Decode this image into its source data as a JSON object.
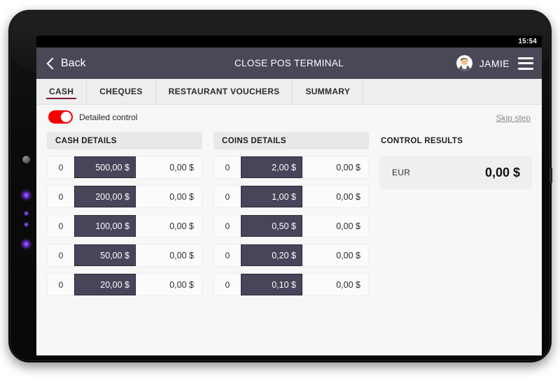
{
  "status_bar": {
    "clock": "15:54"
  },
  "header": {
    "back_label": "Back",
    "title": "CLOSE POS TERMINAL",
    "user_name": "JAMIE",
    "back_icon": "chevron-left-icon",
    "menu_icon": "hamburger-menu-icon",
    "avatar_icon": "user-avatar-icon"
  },
  "tabs": [
    {
      "label": "CASH",
      "active": true
    },
    {
      "label": "CHEQUES",
      "active": false
    },
    {
      "label": "RESTAURANT VOUCHERS",
      "active": false
    },
    {
      "label": "SUMMARY",
      "active": false
    }
  ],
  "toolbar": {
    "detailed_control_label": "Detailed control",
    "detailed_control_on": true,
    "toggle_color": "#f40000",
    "skip_step_label": "Skip step"
  },
  "cash_section": {
    "header": "CASH DETAILS",
    "rows": [
      {
        "count": "0",
        "denomination": "500,00 $",
        "total": "0,00 $"
      },
      {
        "count": "0",
        "denomination": "200,00 $",
        "total": "0,00 $"
      },
      {
        "count": "0",
        "denomination": "100,00 $",
        "total": "0,00 $"
      },
      {
        "count": "0",
        "denomination": "50,00 $",
        "total": "0,00 $"
      },
      {
        "count": "0",
        "denomination": "20,00 $",
        "total": "0,00 $"
      }
    ]
  },
  "coins_section": {
    "header": "COINS DETAILS",
    "rows": [
      {
        "count": "0",
        "denomination": "2,00 $",
        "total": "0,00 $"
      },
      {
        "count": "0",
        "denomination": "1,00 $",
        "total": "0,00 $"
      },
      {
        "count": "0",
        "denomination": "0,50 $",
        "total": "0,00 $"
      },
      {
        "count": "0",
        "denomination": "0,20 $",
        "total": "0,00 $"
      },
      {
        "count": "0",
        "denomination": "0,10 $",
        "total": "0,00 $"
      }
    ]
  },
  "results_section": {
    "header": "CONTROL RESULTS",
    "currency": "EUR",
    "amount": "0,00 $"
  },
  "theme": {
    "header_bg": "#4a4857",
    "accent": "#8a1538",
    "input_bg": "#46455a",
    "screen_bg": "#f7f7f7"
  }
}
